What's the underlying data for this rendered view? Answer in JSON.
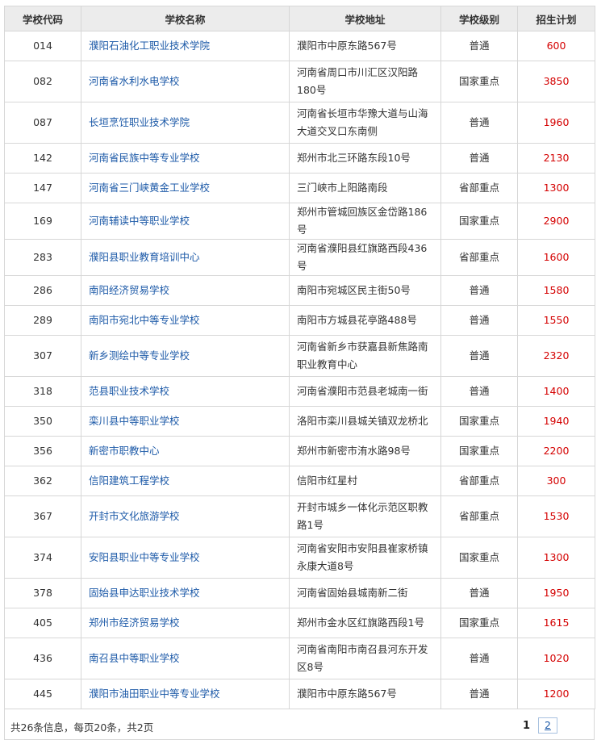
{
  "table": {
    "headers": [
      "学校代码",
      "学校名称",
      "学校地址",
      "学校级别",
      "招生计划"
    ],
    "rows": [
      {
        "code": "014",
        "name": "濮阳石油化工职业技术学院",
        "address": "濮阳市中原东路567号",
        "level": "普通",
        "plan": "600",
        "tall": false
      },
      {
        "code": "082",
        "name": "河南省水利水电学校",
        "address": "河南省周口市川汇区汉阳路180号",
        "level": "国家重点",
        "plan": "3850",
        "tall": true
      },
      {
        "code": "087",
        "name": "长垣烹饪职业技术学院",
        "address": "河南省长垣市华豫大道与山海大道交叉口东南侧",
        "level": "普通",
        "plan": "1960",
        "tall": true
      },
      {
        "code": "142",
        "name": "河南省民族中等专业学校",
        "address": "郑州市北三环路东段10号",
        "level": "普通",
        "plan": "2130",
        "tall": false
      },
      {
        "code": "147",
        "name": "河南省三门峡黄金工业学校",
        "address": "三门峡市上阳路南段",
        "level": "省部重点",
        "plan": "1300",
        "tall": false
      },
      {
        "code": "169",
        "name": "河南辅读中等职业学校",
        "address": "郑州市管城回族区金岱路186号",
        "level": "国家重点",
        "plan": "2900",
        "tall": false
      },
      {
        "code": "283",
        "name": "濮阳县职业教育培训中心",
        "address": "河南省濮阳县红旗路西段436号",
        "level": "省部重点",
        "plan": "1600",
        "tall": false
      },
      {
        "code": "286",
        "name": "南阳经济贸易学校",
        "address": "南阳市宛城区民主街50号",
        "level": "普通",
        "plan": "1580",
        "tall": false
      },
      {
        "code": "289",
        "name": "南阳市宛北中等专业学校",
        "address": "南阳市方城县花亭路488号",
        "level": "普通",
        "plan": "1550",
        "tall": false
      },
      {
        "code": "307",
        "name": "新乡测绘中等专业学校",
        "address": "河南省新乡市获嘉县新焦路南职业教育中心",
        "level": "普通",
        "plan": "2320",
        "tall": true
      },
      {
        "code": "318",
        "name": "范县职业技术学校",
        "address": "河南省濮阳市范县老城南一街",
        "level": "普通",
        "plan": "1400",
        "tall": false
      },
      {
        "code": "350",
        "name": "栾川县中等职业学校",
        "address": "洛阳市栾川县城关镇双龙桥北",
        "level": "国家重点",
        "plan": "1940",
        "tall": false
      },
      {
        "code": "356",
        "name": "新密市职教中心",
        "address": "郑州市新密市洧水路98号",
        "level": "国家重点",
        "plan": "2200",
        "tall": false
      },
      {
        "code": "362",
        "name": "信阳建筑工程学校",
        "address": "信阳市红星村",
        "level": "省部重点",
        "plan": "300",
        "tall": false
      },
      {
        "code": "367",
        "name": "开封市文化旅游学校",
        "address": "开封市城乡一体化示范区职教路1号",
        "level": "省部重点",
        "plan": "1530",
        "tall": true
      },
      {
        "code": "374",
        "name": "安阳县职业中等专业学校",
        "address": "河南省安阳市安阳县崔家桥镇永康大道8号",
        "level": "国家重点",
        "plan": "1300",
        "tall": true
      },
      {
        "code": "378",
        "name": "固始县申达职业技术学校",
        "address": "河南省固始县城南新二街",
        "level": "普通",
        "plan": "1950",
        "tall": false
      },
      {
        "code": "405",
        "name": "郑州市经济贸易学校",
        "address": "郑州市金水区红旗路西段1号",
        "level": "国家重点",
        "plan": "1615",
        "tall": false
      },
      {
        "code": "436",
        "name": "南召县中等职业学校",
        "address": "河南省南阳市南召县河东开发区8号",
        "level": "普通",
        "plan": "1020",
        "tall": true
      },
      {
        "code": "445",
        "name": "濮阳市油田职业中等专业学校",
        "address": "濮阳市中原东路567号",
        "level": "普通",
        "plan": "1200",
        "tall": false
      }
    ]
  },
  "footer": {
    "info": "共26条信息，每页20条，共2页",
    "current_page": "1",
    "next_page": "2"
  },
  "colors": {
    "link": "#1d5aa8",
    "plan": "#d40000",
    "header_bg": "#ececec",
    "border": "#d7d7d7"
  }
}
